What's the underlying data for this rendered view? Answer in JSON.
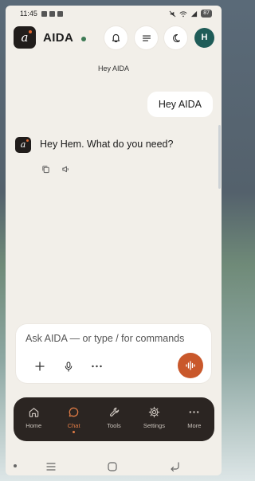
{
  "status_bar": {
    "time": "11:45",
    "battery": "87"
  },
  "header": {
    "logo_letter": "a",
    "title": "AIDA",
    "avatar_initial": "H",
    "icons": [
      "bell-icon",
      "menu-icon",
      "moon-icon"
    ]
  },
  "conversation": {
    "title": "Hey AIDA",
    "messages": [
      {
        "role": "user",
        "text": "Hey AIDA"
      },
      {
        "role": "assistant",
        "avatar_letter": "a",
        "text": "Hey Hem. What do you need?"
      }
    ]
  },
  "composer": {
    "placeholder": "Ask AIDA — or type / for commands",
    "value": ""
  },
  "nav": {
    "items": [
      {
        "label": "Home",
        "icon": "home-icon",
        "active": false
      },
      {
        "label": "Chat",
        "icon": "chat-icon",
        "active": true
      },
      {
        "label": "Tools",
        "icon": "wrench-icon",
        "active": false
      },
      {
        "label": "Settings",
        "icon": "gear-icon",
        "active": false
      },
      {
        "label": "More",
        "icon": "more-dots-icon",
        "active": false
      }
    ]
  },
  "colors": {
    "accent": "#c9582b",
    "online": "#3d7a55",
    "nav_bg": "#2b2522",
    "surface": "#f2efe9"
  }
}
